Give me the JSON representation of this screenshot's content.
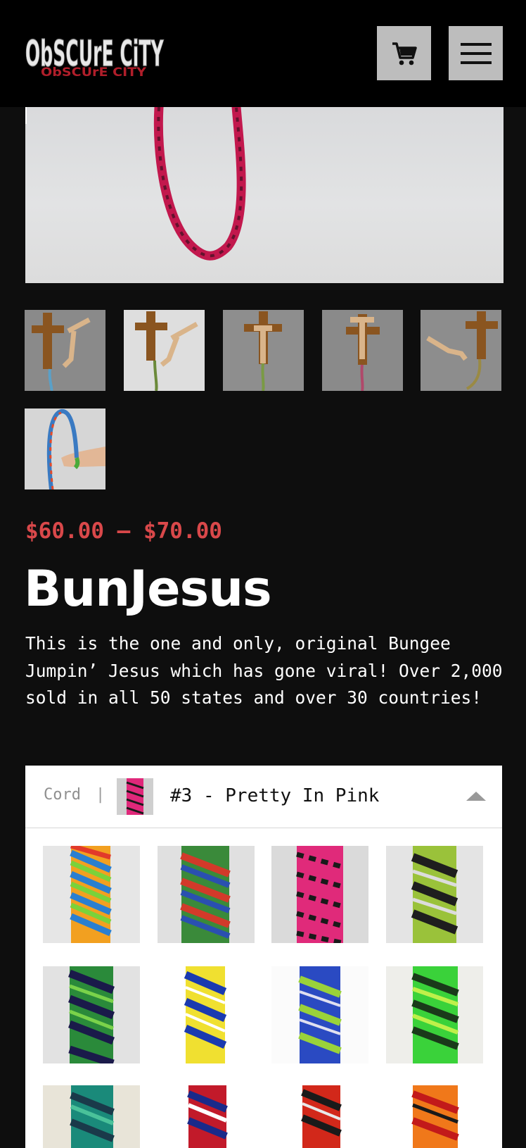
{
  "header": {
    "logo_text": "ObSCUrE CiTY",
    "logo_subtext": "ObSCUrE CITY",
    "cart_icon": "cart-icon",
    "menu_icon": "hamburger-menu-icon"
  },
  "gallery": {
    "thumbnail_count": 6
  },
  "product": {
    "price": "$60.00 – $70.00",
    "title": "BunJesus",
    "description": "This is the one and only, original Bungee Jumpin’ Jesus which has gone viral! Over 2,000 sold in all 50 states and over 30 countries!"
  },
  "variation": {
    "label": "Cord",
    "separator": "|",
    "selected_value": "#3 - Pretty In Pink",
    "options_visible": 12
  },
  "colors": {
    "price": "#d9484a",
    "header_bg": "#000000",
    "page_bg": "#0e0e0e",
    "button_bg": "#bdbdbd"
  }
}
